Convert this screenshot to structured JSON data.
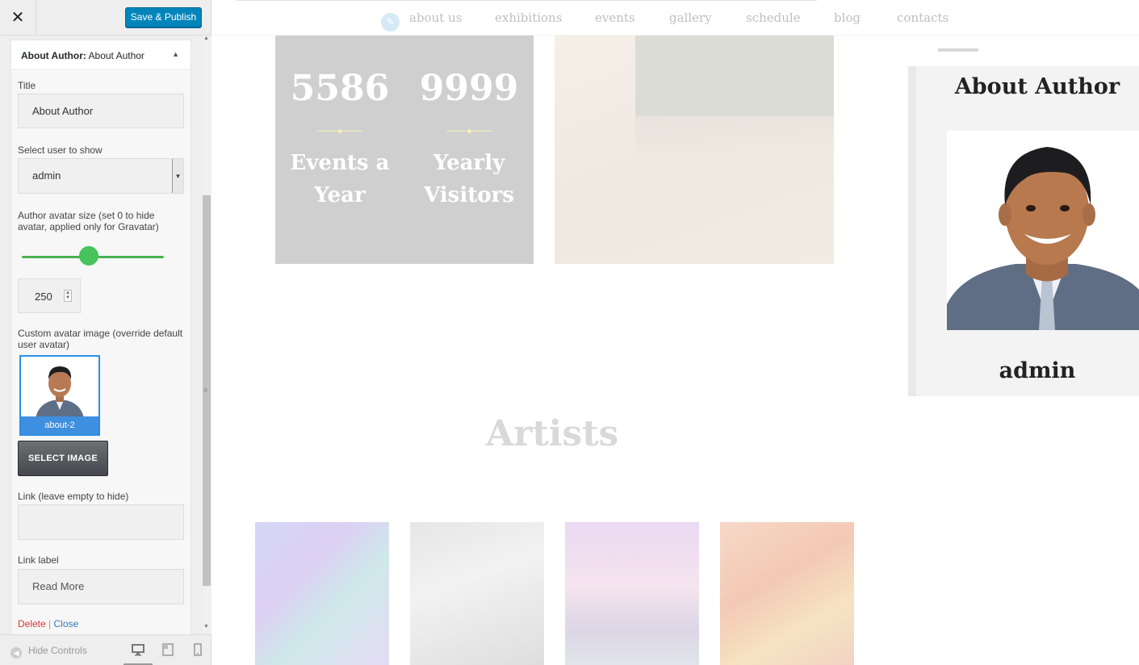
{
  "panel": {
    "close_icon": "✕",
    "publish_label": "Save & Publish",
    "widget": {
      "title_bold": "About Author:",
      "title_rest": " About Author",
      "collapse_icon": "▲"
    },
    "fields": {
      "title_label": "Title",
      "title_value": "About Author",
      "user_label": "Select user to show",
      "user_value": "admin",
      "user_select_arrow": "▾",
      "size_label": "Author avatar size (set 0 to hide avatar, applied only for Gravatar)",
      "size_value": "250",
      "size_fraction": 0.47,
      "spin_up": "▲",
      "spin_down": "▼",
      "custom_label": "Custom avatar image (override default user avatar)",
      "image_caption": "about-2",
      "select_image_label": "SELECT IMAGE",
      "link_label": "Link (leave empty to hide)",
      "link_value": "",
      "linklabel_label": "Link label",
      "linklabel_value": "Read More"
    },
    "actions": {
      "delete": "Delete",
      "separator": "|",
      "close": "Close"
    },
    "footer": {
      "hide_icon": "◀",
      "hide_label": "Hide Controls",
      "devices": [
        "desktop-icon",
        "tablet-icon",
        "mobile-icon"
      ]
    },
    "scrollbar": {
      "grip": "≡",
      "up": "▲",
      "down": "▼"
    }
  },
  "preview": {
    "edit_icon": "✎",
    "nav": [
      "about us",
      "exhibitions",
      "events",
      "gallery",
      "schedule",
      "blog",
      "contacts"
    ],
    "stats": [
      {
        "number": "5586",
        "label_line1": "Events a",
        "label_line2": "Year"
      },
      {
        "number": "9999",
        "label_line1": "Yearly",
        "label_line2": "Visitors"
      }
    ],
    "sidebar": {
      "title": "About Author",
      "name": "admin"
    },
    "artists_title": "Artists"
  },
  "colors": {
    "publish": "#0085ba",
    "slider": "#46b450",
    "delete": "#d63638",
    "close_link": "#2e79be",
    "stats_bg": "#cfcfcf"
  }
}
